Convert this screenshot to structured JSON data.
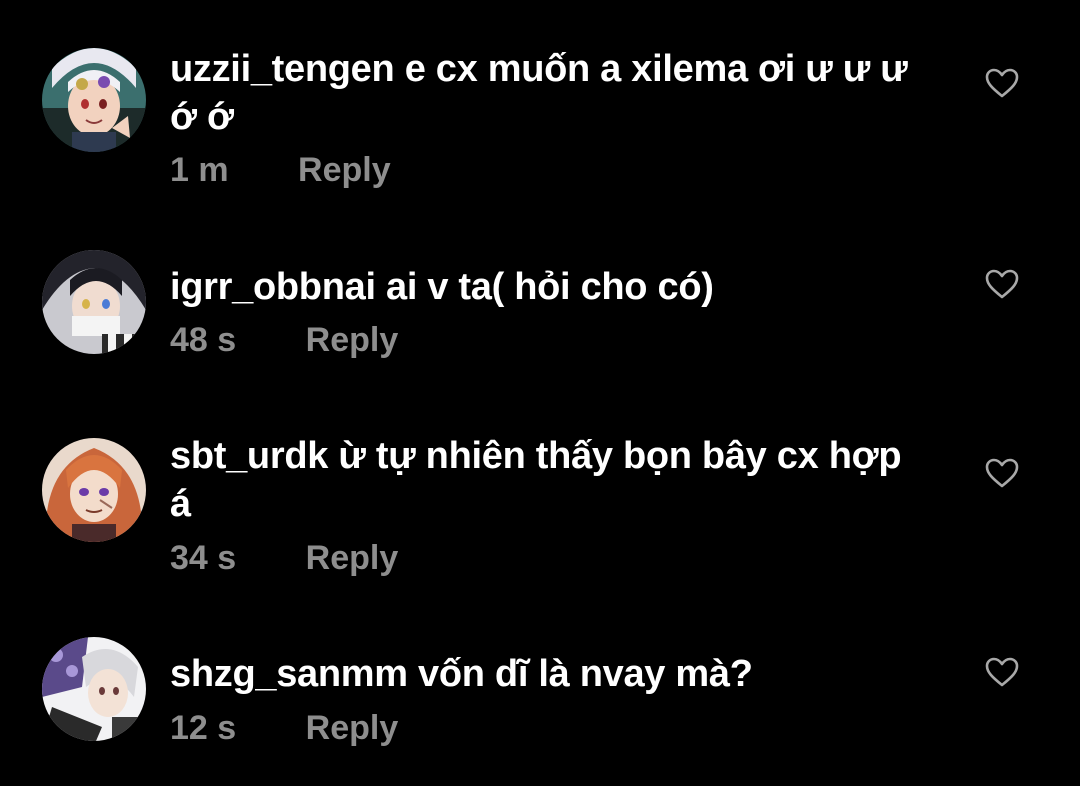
{
  "comments": [
    {
      "username": "uzzii_tengen",
      "text": "e cx muốn a xilema ơi ư ư ư ớ ớ",
      "time": "1 m",
      "reply_label": "Reply",
      "avatar_icon": "avatar-anime-white-hair",
      "like_icon": "heart-outline-icon"
    },
    {
      "username": "igrr_obbnai",
      "text": "ai v ta( hỏi cho có)",
      "time": "48 s",
      "reply_label": "Reply",
      "avatar_icon": "avatar-anime-dark-hair",
      "like_icon": "heart-outline-icon"
    },
    {
      "username": "sbt_urdk",
      "text": "ừ tự nhiên thấy bọn bây cx hợp á",
      "time": "34 s",
      "reply_label": "Reply",
      "avatar_icon": "avatar-anime-orange-hair",
      "like_icon": "heart-outline-icon"
    },
    {
      "username": "shzg_sanmm",
      "text": "vốn dĩ là nvay mà?",
      "time": "12 s",
      "reply_label": "Reply",
      "avatar_icon": "avatar-anime-silver-hair",
      "like_icon": "heart-outline-icon"
    }
  ],
  "colors": {
    "background": "#000000",
    "text": "#ffffff",
    "meta": "#8e8e8e",
    "heart": "#a8a8a8"
  }
}
